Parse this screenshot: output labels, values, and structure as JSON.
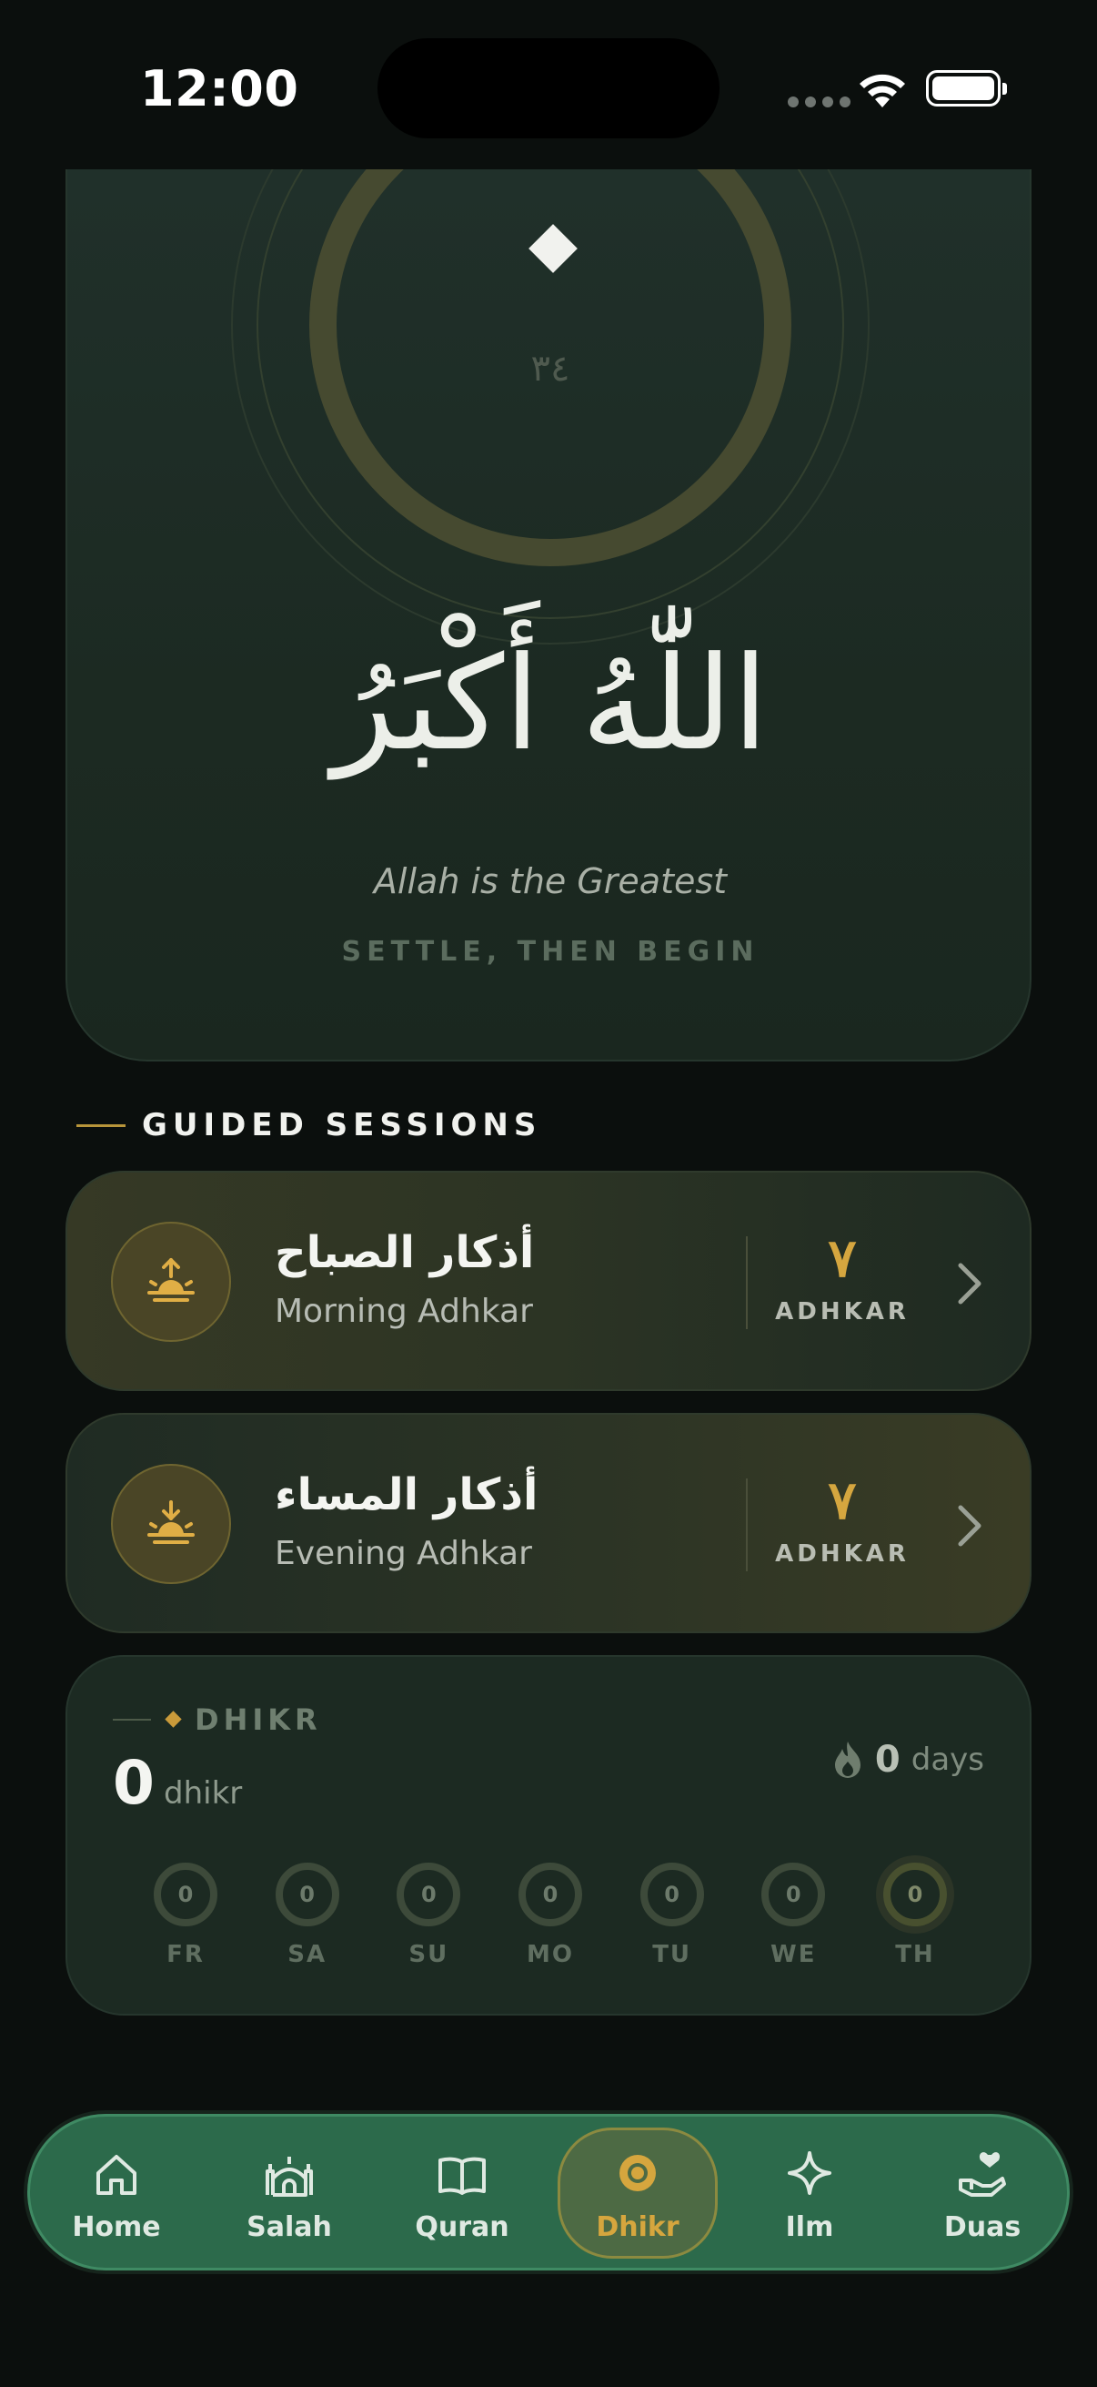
{
  "status_bar": {
    "time": "12:00"
  },
  "hero": {
    "counter": "٣٤",
    "arabic": "اللّٰهُ أَكْبَرُ",
    "translation": "Allah is the Greatest",
    "instruction": "SETTLE, THEN BEGIN"
  },
  "guided_sessions": {
    "title": "GUIDED SESSIONS",
    "items": [
      {
        "arabic": "أذكار الصباح",
        "english": "Morning Adhkar",
        "count": "٧",
        "count_label": "ADHKAR",
        "icon": "sunrise-icon"
      },
      {
        "arabic": "أذكار المساء",
        "english": "Evening Adhkar",
        "count": "٧",
        "count_label": "ADHKAR",
        "icon": "sunset-icon"
      }
    ]
  },
  "dhikr_stats": {
    "title": "DHIKR",
    "count": "0",
    "unit": "dhikr",
    "streak_count": "0",
    "streak_unit": "days",
    "days": [
      {
        "label": "FR",
        "value": "0"
      },
      {
        "label": "SA",
        "value": "0"
      },
      {
        "label": "SU",
        "value": "0"
      },
      {
        "label": "MO",
        "value": "0"
      },
      {
        "label": "TU",
        "value": "0"
      },
      {
        "label": "WE",
        "value": "0"
      },
      {
        "label": "TH",
        "value": "0"
      }
    ]
  },
  "tabbar": {
    "active": "Dhikr",
    "tabs": [
      {
        "label": "Home",
        "icon": "home-icon"
      },
      {
        "label": "Salah",
        "icon": "mosque-icon"
      },
      {
        "label": "Quran",
        "icon": "book-icon"
      },
      {
        "label": "Dhikr",
        "icon": "dhikr-ring-icon"
      },
      {
        "label": "Ilm",
        "icon": "sparkle-icon"
      },
      {
        "label": "Duas",
        "icon": "hand-heart-icon"
      }
    ]
  },
  "colors": {
    "accent_gold": "#d5a63f",
    "tabbar_green": "#2c6a4b",
    "background": "#0b0f0d"
  }
}
